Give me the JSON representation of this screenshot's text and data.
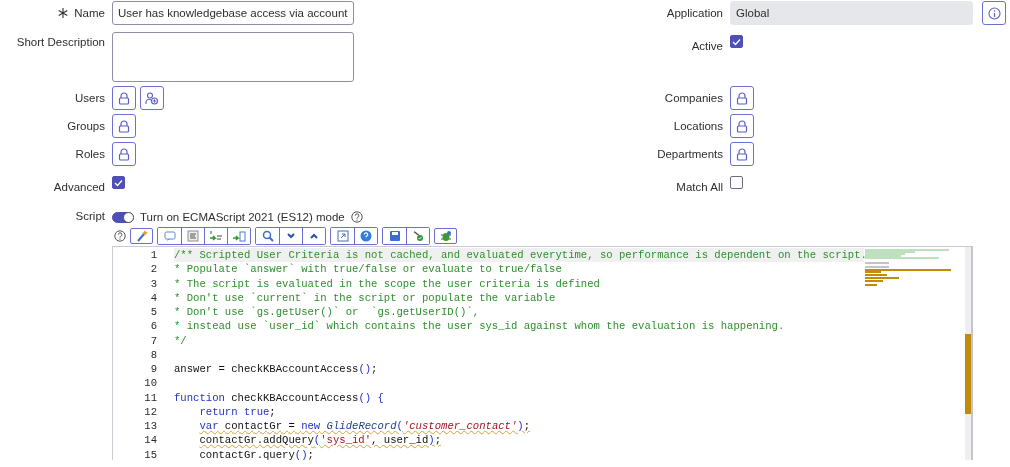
{
  "form_rows": [
    {
      "left": {
        "kind": "text",
        "label": "Name",
        "required": true,
        "value": "User has knowledgebase access via account"
      },
      "right": {
        "kind": "readonly",
        "label": "Application",
        "value": "Global",
        "info": true
      }
    },
    {
      "left": {
        "kind": "textarea",
        "label": "Short Description",
        "required": false
      },
      "right": {
        "kind": "checkbox",
        "label": "Active",
        "checked": true
      }
    },
    {
      "left": {
        "kind": "lookup",
        "label": "Users",
        "add_user": true
      },
      "right": {
        "kind": "lookup",
        "label": "Companies",
        "add_user": false
      }
    },
    {
      "left": {
        "kind": "lookup",
        "label": "Groups",
        "add_user": false
      },
      "right": {
        "kind": "lookup",
        "label": "Locations",
        "add_user": false
      }
    },
    {
      "left": {
        "kind": "lookup",
        "label": "Roles",
        "add_user": false
      },
      "right": {
        "kind": "lookup",
        "label": "Departments",
        "add_user": false
      }
    },
    {
      "left": {
        "kind": "checkbox",
        "label": "Advanced",
        "checked": true
      },
      "right": {
        "kind": "checkbox",
        "label": "Match All",
        "checked": false
      }
    }
  ],
  "script": {
    "label": "Script",
    "toggle": {
      "label": "Turn on ECMAScript 2021 (ES12) mode",
      "on": true
    },
    "lines": [
      {
        "number": "1",
        "active": true,
        "warning": false,
        "tokens": [
          {
            "kind": "comment",
            "text": "/** Scripted User Criteria is not cached, and evaluated everytime, so performance is dependent on the script."
          }
        ]
      },
      {
        "number": "2",
        "active": false,
        "warning": false,
        "tokens": [
          {
            "kind": "comment",
            "text": "* Populate `answer` with true/false or evaluate to true/false"
          }
        ]
      },
      {
        "number": "3",
        "active": false,
        "warning": false,
        "tokens": [
          {
            "kind": "comment",
            "text": "* The script is evaluated in the scope the user criteria is defined"
          }
        ]
      },
      {
        "number": "4",
        "active": false,
        "warning": false,
        "tokens": [
          {
            "kind": "comment",
            "text": "* Don't use `current` in the script or populate the variable"
          }
        ]
      },
      {
        "number": "5",
        "active": false,
        "warning": false,
        "tokens": [
          {
            "kind": "comment",
            "text": "* Don't use `gs.getUser()` or  `gs.getUserID()`,"
          }
        ]
      },
      {
        "number": "6",
        "active": false,
        "warning": false,
        "tokens": [
          {
            "kind": "comment",
            "text": "* instead use `user_id` which contains the user sys_id against whom the evaluation is happening."
          }
        ]
      },
      {
        "number": "7",
        "active": false,
        "warning": false,
        "tokens": [
          {
            "kind": "comment",
            "text": "*/"
          }
        ]
      },
      {
        "number": "8",
        "active": false
      },
      {
        "number": "9",
        "active": false,
        "warning": false,
        "tokens": [
          {
            "kind": "plain",
            "text": "answer = checkKBAccountAccess"
          },
          {
            "kind": "punct",
            "text": "()"
          },
          {
            "kind": "plain",
            "text": ";"
          }
        ]
      },
      {
        "number": "10",
        "active": false
      },
      {
        "number": "11",
        "active": false,
        "warning": false,
        "tokens": [
          {
            "kind": "keyword",
            "text": "function"
          },
          {
            "kind": "plain",
            "text": " checkKBAccountAccess"
          },
          {
            "kind": "punct",
            "text": "() {"
          }
        ]
      },
      {
        "number": "12",
        "active": false,
        "warning": false,
        "indented": true,
        "tokens": [
          {
            "kind": "keyword",
            "text": "return true"
          },
          {
            "kind": "plain",
            "text": ";"
          }
        ]
      },
      {
        "number": "13",
        "active": false,
        "warning": true,
        "indented": true,
        "tokens": [
          {
            "kind": "keyword",
            "text": "var"
          },
          {
            "kind": "plain",
            "text": " contactGr = "
          },
          {
            "kind": "keyword",
            "text": "new"
          },
          {
            "kind": "class",
            "text": " GlideRecord"
          },
          {
            "kind": "punct",
            "text": "("
          },
          {
            "kind": "string",
            "text": "'customer_contact'"
          },
          {
            "kind": "punct",
            "text": ")"
          },
          {
            "kind": "plain",
            "text": ";"
          }
        ]
      },
      {
        "number": "14",
        "active": false,
        "warning": true,
        "indented": true,
        "tokens": [
          {
            "kind": "plain",
            "text": "contactGr.addQuery"
          },
          {
            "kind": "punct",
            "text": "("
          },
          {
            "kind": "string2",
            "text": "'sys_id'"
          },
          {
            "kind": "plain",
            "text": ", user_id"
          },
          {
            "kind": "punct",
            "text": ")"
          },
          {
            "kind": "plain",
            "text": ";"
          }
        ]
      },
      {
        "number": "15",
        "active": false,
        "warning": false,
        "indented": true,
        "tokens": [
          {
            "kind": "plain",
            "text": "contactGr.query"
          },
          {
            "kind": "punct",
            "text": "()"
          },
          {
            "kind": "plain",
            "text": ";"
          }
        ]
      }
    ]
  }
}
